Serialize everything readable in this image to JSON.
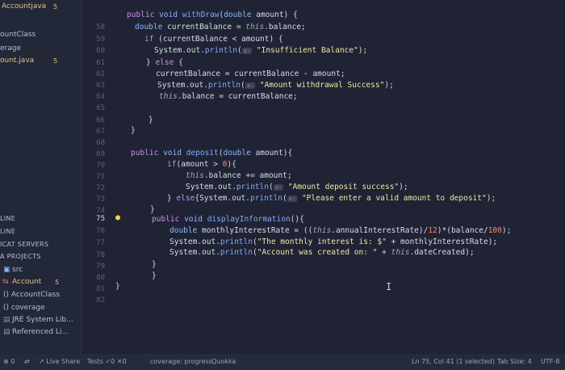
{
  "sidebar": {
    "top_tab": {
      "label": "Accountjava",
      "badge": "5"
    },
    "items": [
      {
        "label": "ountClass"
      },
      {
        "label": "erage"
      },
      {
        "label": "ount.java",
        "badge": "5"
      }
    ],
    "sections": [
      {
        "label": "LINE"
      },
      {
        "label": "LINE"
      },
      {
        "label": "ICAT SERVERS"
      },
      {
        "label": "A PROJECTS"
      }
    ],
    "tree": [
      {
        "label": "src"
      },
      {
        "label": "Account",
        "badge": "5"
      },
      {
        "label": "() AccountClass"
      },
      {
        "label": "() coverage"
      },
      {
        "label": "JRE System Lib..."
      },
      {
        "label": "Referenced Li..."
      }
    ]
  },
  "gutter": {
    "lines": [
      "58",
      "59",
      "60",
      "61",
      "62",
      "63",
      "64",
      "65",
      "66",
      "67",
      "68",
      "69",
      "70",
      "71",
      "72",
      "73",
      "74",
      "75",
      "76",
      "77",
      "78",
      "79",
      "80",
      "81",
      "82"
    ],
    "current_line": "75"
  },
  "code": {
    "l58": {
      "k1": "public",
      "t1": "void",
      "f1": "withDraw",
      "p1": "(",
      "t2": "double",
      "r1": " amount) {"
    },
    "l59": {
      "t1": "double",
      "r1": " currentBalance = ",
      "th": "this",
      "r2": ".balance;"
    },
    "l60": {
      "k1": "if",
      "r1": " (currentBalance < amount) {"
    },
    "l61": {
      "r1": "System.out.",
      "f1": "println",
      "p1": "(",
      "hint": "x:",
      "s1": "\"Insufficient Balance\"",
      "r2": ");"
    },
    "l62": {
      "r1": "} ",
      "k1": "else",
      "r2": " {"
    },
    "l63": {
      "r1": "currentBalance = currentBalance - amount;"
    },
    "l64": {
      "r1": "System.out.",
      "f1": "println",
      "p1": "(",
      "hint": "x:",
      "s1": "\"Amount withdrawal Success\"",
      "r2": ");"
    },
    "l65": {
      "th": "this",
      "r1": ".balance = currentBalance;"
    },
    "l67": {
      "r1": "}"
    },
    "l68": {
      "r1": "}"
    },
    "l70": {
      "k1": "public",
      "t1": "void",
      "f1": "deposit",
      "p1": "(",
      "t2": "double",
      "r1": " amount){"
    },
    "l71": {
      "k1": "if",
      "r1": "(amount > ",
      "n1": "0",
      "r2": "){"
    },
    "l72": {
      "th": "this",
      "r1": ".balance += amount;"
    },
    "l73": {
      "r1": "System.out.",
      "f1": "println",
      "p1": "(",
      "hint": "x:",
      "s1": "\"Amount deposit success\"",
      "r2": ");"
    },
    "l74": {
      "r1": "} ",
      "k1": "else",
      "r2": "{System.out.",
      "f1": "println",
      "p1": "(",
      "hint": "x:",
      "s1": "\"Please enter a valid amount to deposit\"",
      "r3": ");"
    },
    "l75": {
      "r1": "}"
    },
    "l76": {
      "k1": "public",
      "t1": "void",
      "f1": "displayInformation",
      "r1": "(){"
    },
    "l77": {
      "t1": "double",
      "r1": " monthlyInterestRate = ((",
      "th": "this",
      "r2": ".annualInterestRate)/",
      "n1": "12",
      "r3": ")*(balance/",
      "n2": "100",
      "r4": ");"
    },
    "l78": {
      "r1": "System.out.",
      "f1": "println",
      "p1": "(",
      "s1": "\"The monthly interest is: $\"",
      "r2": " + monthlyInterestRate);"
    },
    "l79": {
      "r1": "System.out.",
      "f1": "println",
      "p1": "(",
      "s1": "\"Account was created on: \"",
      "r2": " + ",
      "th": "this",
      "r3": ".dateCreated);"
    },
    "l80": {
      "r1": "}"
    },
    "l81": {
      "r1": "}"
    },
    "l82": {
      "r1": "}"
    }
  },
  "statusbar": {
    "errors": "0",
    "live_share": "Live Share",
    "tests": "Tests",
    "tests_pass": "0",
    "tests_fail": "0",
    "coverage": "coverage: progress",
    "quokka": "Quokka",
    "position": "Ln 75, Col 41 (1 selected)",
    "tab_size": "Tab Size: 4",
    "encoding": "UTF-8"
  }
}
